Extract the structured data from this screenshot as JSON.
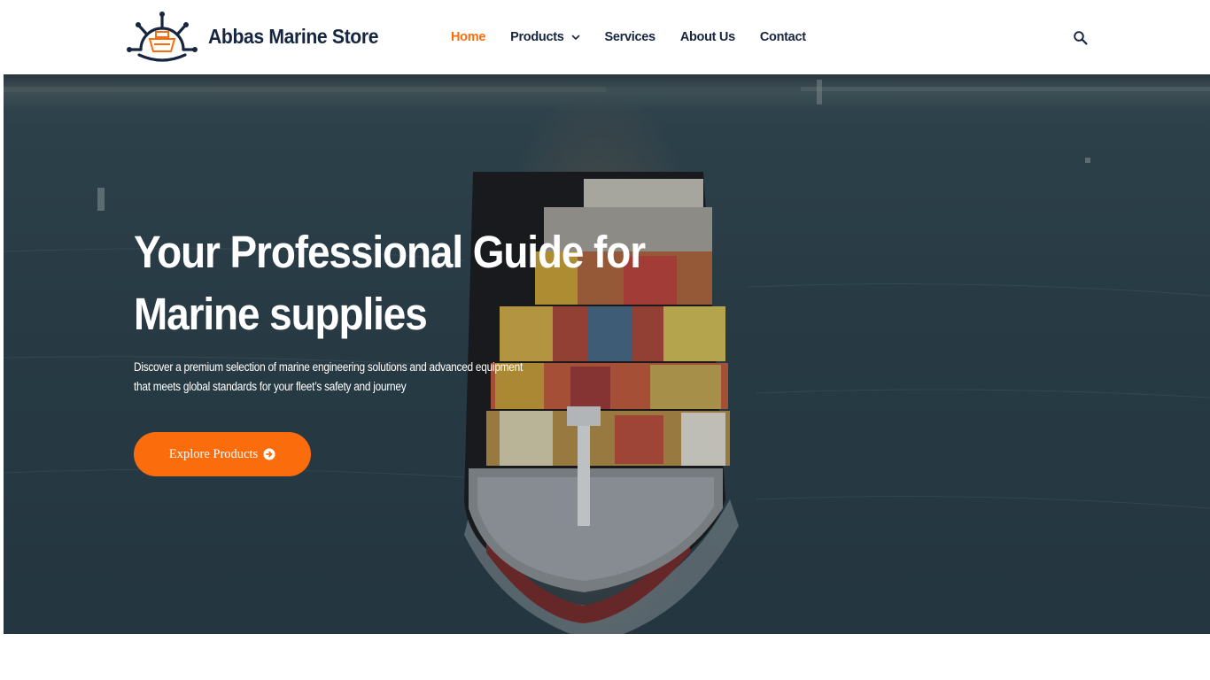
{
  "brand": {
    "name": "Abbas Marine Store",
    "logo_icon": "ship-wheel-icon"
  },
  "nav": {
    "items": [
      {
        "label": "Home",
        "active": true
      },
      {
        "label": "Products",
        "has_dropdown": true
      },
      {
        "label": "Services"
      },
      {
        "label": "About Us"
      },
      {
        "label": "Contact"
      }
    ],
    "search_icon": "search-icon"
  },
  "hero": {
    "title": "Your Professional Guide for Marine supplies",
    "subtitle": "Discover a premium selection of marine engineering solutions and advanced equipment that meets global standards for your fleet’s safety and journey",
    "cta_label": "Explore Products",
    "cta_icon": "arrow-circle-right-icon",
    "background": "container-ship-aerial-photo"
  },
  "colors": {
    "accent": "#fb6d0c",
    "navy": "#172640",
    "text_on_hero": "#ffffff"
  }
}
